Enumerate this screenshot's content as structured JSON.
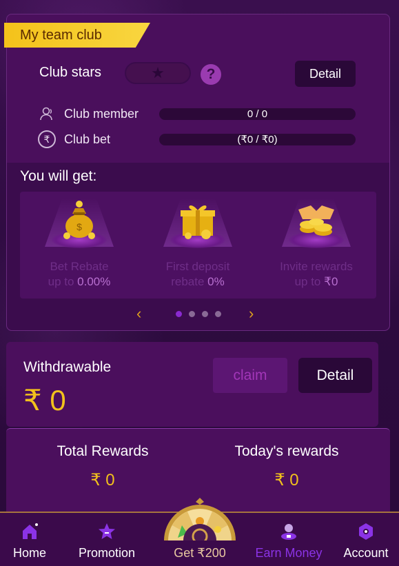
{
  "club": {
    "title": "My team club",
    "stars_label": "Club stars",
    "detail_button": "Detail",
    "help_glyph": "?",
    "member_label": "Club member",
    "member_value": "0 / 0",
    "bet_label": "Club bet",
    "bet_value": "(₹0 / ₹0)"
  },
  "rewards": {
    "heading": "You will get:",
    "items": [
      {
        "line1": "Bet Rebate",
        "line2_prefix": "up to ",
        "line2_value": "0.00%",
        "icon": "money-bag-icon"
      },
      {
        "line1": "First deposit",
        "line2_prefix": "rebate ",
        "line2_value": "0%",
        "icon": "gift-box-icon"
      },
      {
        "line1": "Invite rewards",
        "line2_prefix": "up to ",
        "line2_value": "₹0",
        "icon": "handshake-coins-icon"
      }
    ],
    "pager": {
      "prev": "‹",
      "next": "›",
      "dots": 4,
      "active": 0
    }
  },
  "withdraw": {
    "label": "Withdrawable",
    "amount": "₹ 0",
    "claim_button": "claim",
    "detail_button": "Detail"
  },
  "totals": {
    "total_label": "Total Rewards",
    "total_value": "₹ 0",
    "today_label": "Today's rewards",
    "today_value": "₹ 0"
  },
  "nav": {
    "items": [
      {
        "label": "Home",
        "icon": "home-icon"
      },
      {
        "label": "Promotion",
        "icon": "promotion-icon"
      },
      {
        "label": "Get ₹200",
        "icon": "lucky-wheel-icon"
      },
      {
        "label": "Earn Money",
        "icon": "earn-money-icon"
      },
      {
        "label": "Account",
        "icon": "account-icon"
      }
    ]
  },
  "colors": {
    "accent_gold": "#f2c11c",
    "accent_purple": "#8a2ad0",
    "background": "#2c0a3c"
  }
}
